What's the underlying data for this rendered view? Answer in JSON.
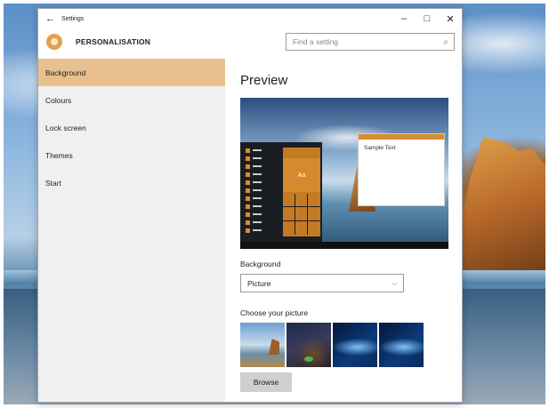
{
  "window": {
    "title": "Settings",
    "back_glyph": "←",
    "minimize_glyph": "–",
    "maximize_glyph": "□",
    "close_glyph": "✕"
  },
  "header": {
    "title": "PERSONALISATION",
    "icon": "gear-icon",
    "search_placeholder": "Find a setting",
    "search_icon": "search-icon",
    "search_glyph": "⌕"
  },
  "sidebar": {
    "items": [
      {
        "label": "Background",
        "selected": true
      },
      {
        "label": "Colours",
        "selected": false
      },
      {
        "label": "Lock screen",
        "selected": false
      },
      {
        "label": "Themes",
        "selected": false
      },
      {
        "label": "Start",
        "selected": false
      }
    ]
  },
  "main": {
    "preview_heading": "Preview",
    "preview_tile_label": "Aa",
    "preview_sample_text": "Sample Text",
    "background_label": "Background",
    "background_value": "Picture",
    "chevron_glyph": "⌵",
    "choose_label": "Choose your picture",
    "browse_label": "Browse"
  },
  "colors": {
    "accent": "#d98c2e",
    "selected_nav": "#e8c08f",
    "sidebar_bg": "#f0f0f0"
  }
}
